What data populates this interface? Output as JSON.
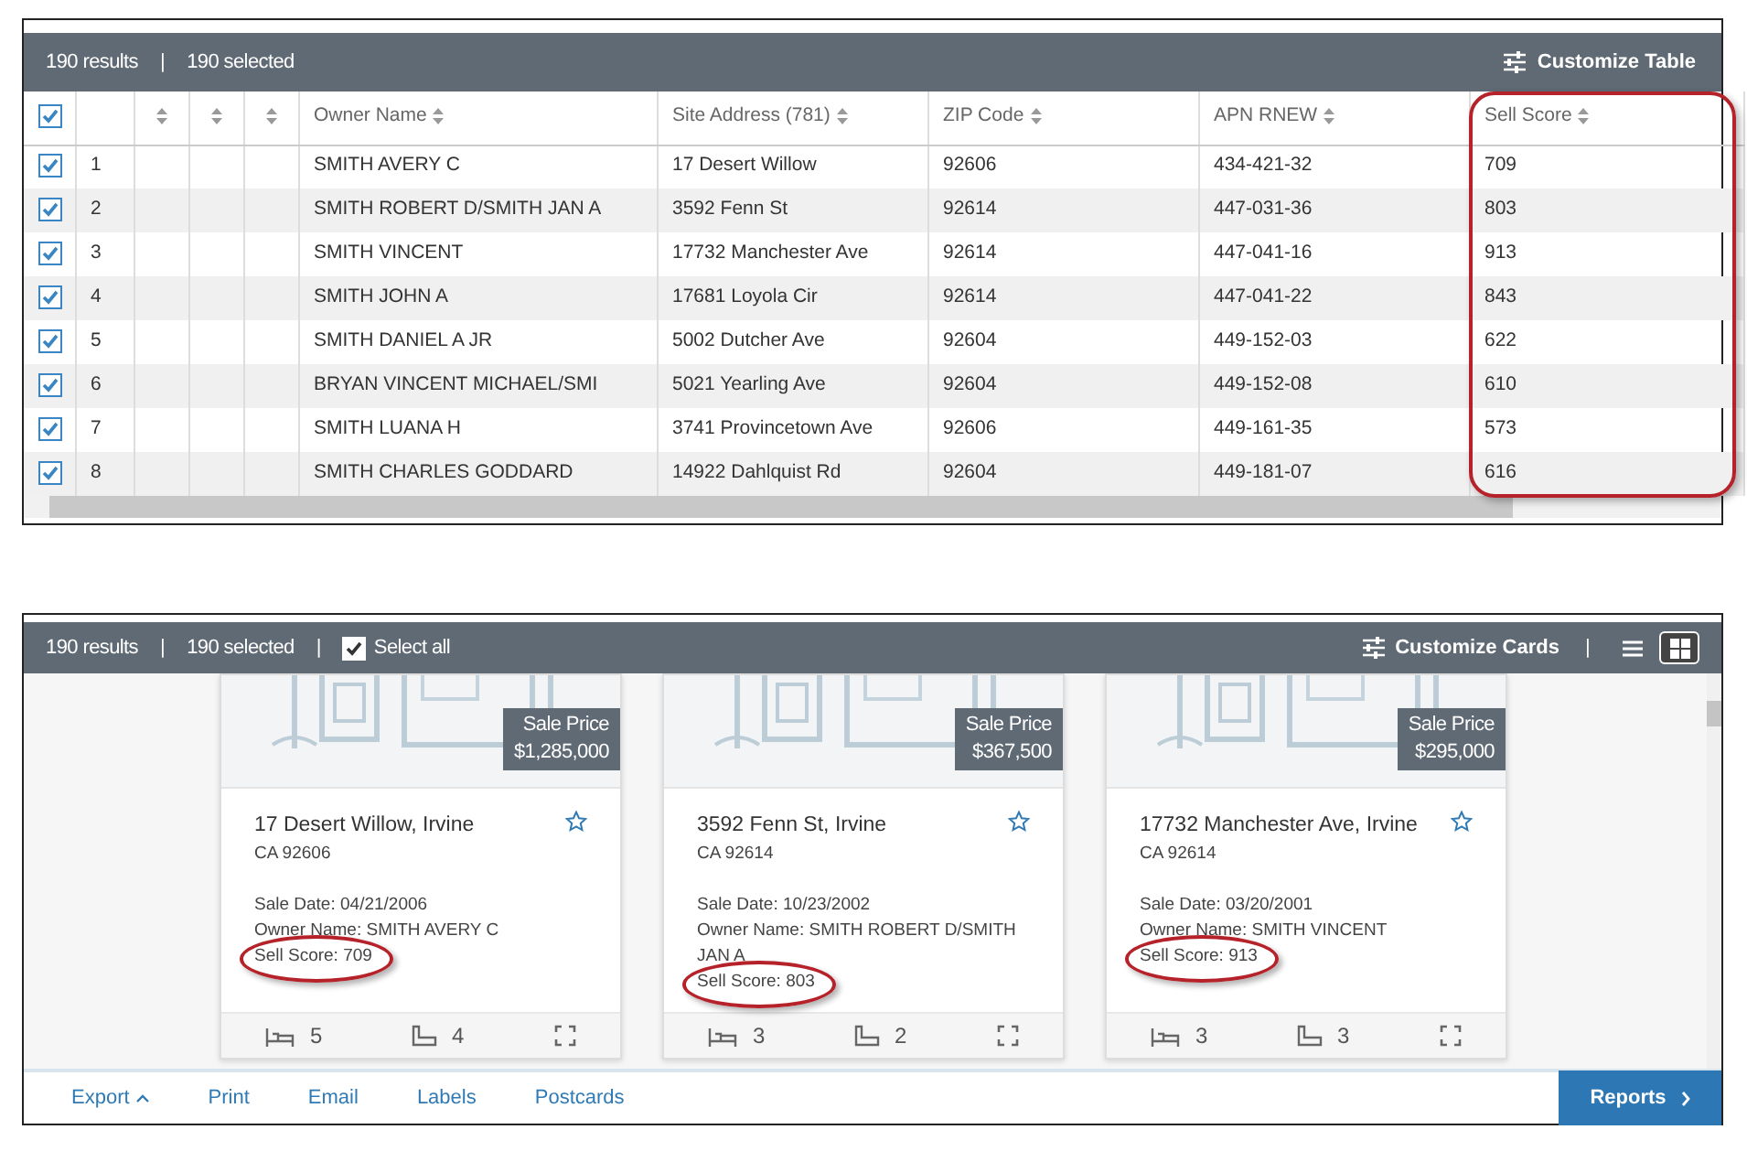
{
  "table_view": {
    "header": {
      "results": "190 results",
      "separator": "|",
      "selected": "190 selected",
      "customize": "Customize Table"
    },
    "select_all_checked": true,
    "columns": [
      {
        "kind": "number"
      },
      {
        "kind": "blank",
        "sortable": true
      },
      {
        "kind": "blank",
        "sortable": true
      },
      {
        "kind": "blank",
        "sortable": true
      },
      {
        "kind": "owner",
        "label": "Owner Name",
        "sortable": true
      },
      {
        "kind": "address",
        "label": "Site Address (781)",
        "sortable": true
      },
      {
        "kind": "zip",
        "label": "ZIP Code",
        "sortable": true
      },
      {
        "kind": "apn",
        "label": "APN RNEW",
        "sortable": true
      },
      {
        "kind": "score",
        "label": "Sell Score",
        "sortable": true,
        "highlighted": true
      }
    ],
    "rows": [
      {
        "checked": true,
        "number": "1",
        "owner": "SMITH AVERY C",
        "address": "17 Desert Willow",
        "zip": "92606",
        "apn": "434-421-32",
        "score": "709"
      },
      {
        "checked": true,
        "number": "2",
        "owner": "SMITH ROBERT D/SMITH JAN A",
        "address": "3592 Fenn St",
        "zip": "92614",
        "apn": "447-031-36",
        "score": "803"
      },
      {
        "checked": true,
        "number": "3",
        "owner": "SMITH VINCENT",
        "address": "17732 Manchester Ave",
        "zip": "92614",
        "apn": "447-041-16",
        "score": "913"
      },
      {
        "checked": true,
        "number": "4",
        "owner": "SMITH JOHN A",
        "address": "17681 Loyola Cir",
        "zip": "92614",
        "apn": "447-041-22",
        "score": "843"
      },
      {
        "checked": true,
        "number": "5",
        "owner": "SMITH DANIEL A JR",
        "address": "5002 Dutcher Ave",
        "zip": "92604",
        "apn": "449-152-03",
        "score": "622"
      },
      {
        "checked": true,
        "number": "6",
        "owner": "BRYAN VINCENT MICHAEL/SMI",
        "address": "5021 Yearling Ave",
        "zip": "92604",
        "apn": "449-152-08",
        "score": "610"
      },
      {
        "checked": true,
        "number": "7",
        "owner": "SMITH LUANA H",
        "address": "3741 Provincetown Ave",
        "zip": "92606",
        "apn": "449-161-35",
        "score": "573"
      },
      {
        "checked": true,
        "number": "8",
        "owner": "SMITH CHARLES GODDARD",
        "address": "14922 Dahlquist Rd",
        "zip": "92604",
        "apn": "449-181-07",
        "score": "616"
      }
    ]
  },
  "card_view": {
    "header": {
      "results": "190 results",
      "separator_1": "|",
      "selected": "190 selected",
      "separator_2": "|",
      "select_all": {
        "label": "Select all",
        "checked": true
      },
      "customize": "Customize Cards",
      "separator_3": "|",
      "view_modes": [
        {
          "kind": "list",
          "selected": false
        },
        {
          "kind": "grid",
          "selected": true
        }
      ]
    },
    "cards": [
      {
        "price_label": "Sale Price",
        "price": "$1,285,000",
        "address": "17 Desert Willow, Irvine",
        "city_zip": "CA 92606",
        "favorite": false,
        "fields": [
          {
            "label": "Sale Date:",
            "value": "04/21/2006"
          },
          {
            "label": "Owner Name:",
            "value": "SMITH AVERY C"
          },
          {
            "label": "Sell Score:",
            "value": "709",
            "highlighted": true
          }
        ],
        "beds": "5",
        "baths": "4"
      },
      {
        "price_label": "Sale Price",
        "price": "$367,500",
        "address": "3592 Fenn St, Irvine",
        "city_zip": "CA 92614",
        "favorite": false,
        "fields": [
          {
            "label": "Sale Date:",
            "value": "10/23/2002"
          },
          {
            "label": "Owner Name:",
            "value": "SMITH ROBERT D/SMITH JAN A"
          },
          {
            "label": "Sell Score:",
            "value": "803",
            "highlighted": true
          }
        ],
        "beds": "3",
        "baths": "2"
      },
      {
        "price_label": "Sale Price",
        "price": "$295,000",
        "address": "17732 Manchester Ave, Irvine",
        "city_zip": "CA 92614",
        "favorite": false,
        "fields": [
          {
            "label": "Sale Date:",
            "value": "03/20/2001"
          },
          {
            "label": "Owner Name:",
            "value": "SMITH VINCENT"
          },
          {
            "label": "Sell Score:",
            "value": "913",
            "highlighted": true
          }
        ],
        "beds": "3",
        "baths": "3"
      }
    ],
    "footer": {
      "actions": [
        {
          "label": "Export",
          "kind": "menu"
        },
        {
          "label": "Print",
          "kind": "link"
        },
        {
          "label": "Email",
          "kind": "link"
        },
        {
          "label": "Labels",
          "kind": "link"
        },
        {
          "label": "Postcards",
          "kind": "link"
        }
      ],
      "reports": "Reports"
    }
  }
}
